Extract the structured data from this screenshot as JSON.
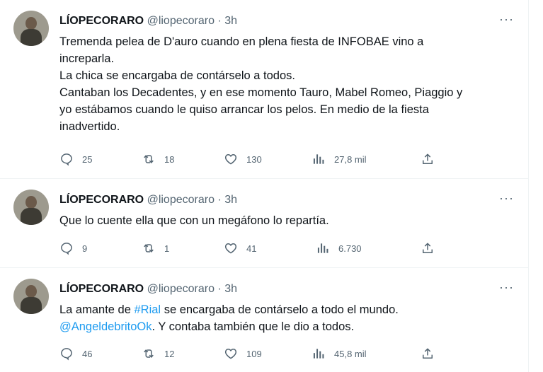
{
  "tweets": [
    {
      "name": "LÍOPECORARO",
      "handle": "@liopecoraro",
      "separator": "·",
      "time": "3h",
      "more": "···",
      "lines": [
        "Tremenda pelea de D'auro cuando en plena fiesta de INFOBAE vino a",
        "increparla.",
        "La chica se encargaba de contárselo a todos.",
        "Cantaban los Decadentes, y en ese momento Tauro, Mabel Romeo, Piaggio y",
        "yo estábamos cuando le quiso arrancar los pelos. En medio de la fiesta",
        "inadvertido."
      ],
      "replies": "25",
      "retweets": "18",
      "likes": "130",
      "views": "27,8 mil"
    },
    {
      "name": "LÍOPECORARO",
      "handle": "@liopecoraro",
      "separator": "·",
      "time": "3h",
      "more": "···",
      "lines": [
        "Que lo cuente ella que con un megáfono lo repartía."
      ],
      "replies": "9",
      "retweets": "1",
      "likes": "41",
      "views": "6.730"
    },
    {
      "name": "LÍOPECORARO",
      "handle": "@liopecoraro",
      "separator": "·",
      "time": "3h",
      "more": "···",
      "line1_prefix": "La amante de ",
      "line1_hashtag": "#Rial",
      "line1_suffix": " se encargaba de contárselo a todo el mundo.",
      "line2_mention": "@AngeldebritoOk",
      "line2_suffix": ". Y contaba también que le dio a todos.",
      "replies": "46",
      "retweets": "12",
      "likes": "109",
      "views": "45,8 mil"
    }
  ],
  "icons": [
    "reply-icon",
    "retweet-icon",
    "like-icon",
    "views-icon",
    "share-icon",
    "more-icon"
  ],
  "colors": {
    "text": "#0f1419",
    "secondary": "#536471",
    "link": "#1d9bf0",
    "divider": "#eff3f4"
  }
}
